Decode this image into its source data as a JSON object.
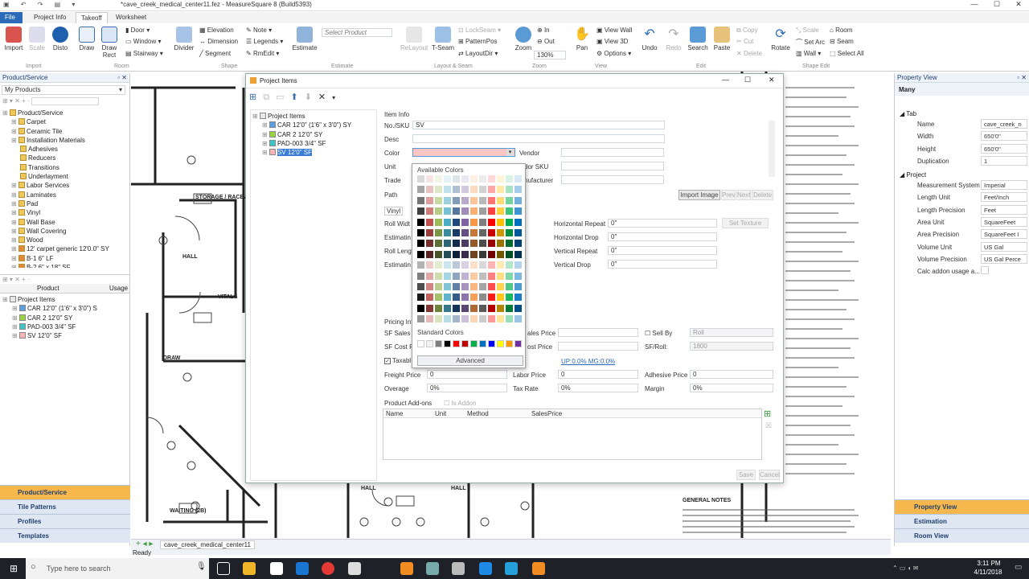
{
  "app": {
    "title": "*cave_creek_medical_center11.fez - MeasureSquare 8 (Build5393)"
  },
  "ribbon_tabs": [
    {
      "label": "File",
      "active": false
    },
    {
      "label": "Project Info",
      "active": false
    },
    {
      "label": "Takeoff",
      "active": true
    },
    {
      "label": "Worksheet",
      "active": false
    }
  ],
  "ribbon": {
    "import": {
      "import": "Import",
      "scale": "Scale",
      "disto": "Disto",
      "group": "Import"
    },
    "room": {
      "draw": "Draw",
      "draw_rect": "Draw\nRect",
      "door": "Door",
      "window": "Window",
      "stairway": "Stairway",
      "group": "Room"
    },
    "shape": {
      "divider": "Divider",
      "elevation": "Elevation",
      "dimension": "Dimension",
      "segment": "Segment",
      "note": "Note",
      "legends": "Legends",
      "rmedit": "RmEdit",
      "group": "Shape"
    },
    "estimate": {
      "estimate": "Estimate",
      "select_product_placeholder": "Select Product",
      "group": "Estimate"
    },
    "layout": {
      "relayout": "ReLayout",
      "tseam": "T-Seam",
      "lockseam": "LockSeam",
      "patternpos": "PatternPos",
      "layoutdir": "LayoutDir",
      "group": "Layout & Seam"
    },
    "zoom": {
      "zoom": "Zoom",
      "in": "In",
      "out": "Out",
      "level": "130%",
      "group": "Zoom"
    },
    "view": {
      "pan": "Pan",
      "view_wall": "View Wall",
      "view_3d": "View 3D",
      "options": "Options",
      "group": "View"
    },
    "edit": {
      "undo": "Undo",
      "redo": "Redo",
      "search": "Search",
      "paste": "Paste",
      "copy": "Copy",
      "cut": "Cut",
      "delete": "Delete",
      "group": "Edit"
    },
    "shape_edit": {
      "rotate": "Rotate",
      "scale": "Scale",
      "set_arc": "Set Arc",
      "wall": "Wall",
      "room": "Room",
      "seam": "Seam",
      "select_all": "Select All",
      "group": "Shape Edit"
    }
  },
  "left_panel": {
    "title": "Product/Service",
    "filter": "My Products",
    "tree": [
      {
        "label": "Product/Service",
        "level": 0
      },
      {
        "label": "Carpet",
        "level": 1
      },
      {
        "label": "Ceramic Tile",
        "level": 1
      },
      {
        "label": "Installation Materials",
        "level": 1
      },
      {
        "label": "Adhesives",
        "level": 2
      },
      {
        "label": "Reducers",
        "level": 2
      },
      {
        "label": "Transitions",
        "level": 2
      },
      {
        "label": "Underlayment",
        "level": 2
      },
      {
        "label": "Labor Services",
        "level": 1
      },
      {
        "label": "Laminates",
        "level": 1
      },
      {
        "label": "Pad",
        "level": 1
      },
      {
        "label": "Vinyl",
        "level": 1
      },
      {
        "label": "Wall Base",
        "level": 1
      },
      {
        "label": "Wall Covering",
        "level": 1
      },
      {
        "label": "Wood",
        "level": 1
      },
      {
        "label": "12' carpet generic 12'0.0\" SY",
        "level": 1
      },
      {
        "label": "B-1 6\" LF",
        "level": 1
      },
      {
        "label": "B-2 6\" x 18\" SF",
        "level": 1
      }
    ],
    "columns": [
      "Product",
      "Usage"
    ],
    "project_items": [
      {
        "label": "Project Items",
        "color": ""
      },
      {
        "label": "CAR 12'0\" (1'6\" x 3'0\") S",
        "color": "#5aa0e0"
      },
      {
        "label": "CAR 2 12'0\" SY",
        "color": "#9bd240"
      },
      {
        "label": "PAD-003 3/4\"  SF",
        "color": "#39c7c7"
      },
      {
        "label": "SV 12'0\" SF",
        "color": "#f7b6b6"
      }
    ],
    "nav": [
      "Product/Service",
      "Tile Patterns",
      "Profiles",
      "Templates"
    ]
  },
  "dialog": {
    "title": "Project Items",
    "tree": [
      {
        "label": "Project Items",
        "color": ""
      },
      {
        "label": "CAR 12'0\" (1'6\" x 3'0\") SY",
        "color": "#5aa0e0"
      },
      {
        "label": "CAR 2 12'0\" SY",
        "color": "#9bd240"
      },
      {
        "label": "PAD-003 3/4\"  SF",
        "color": "#39c7c7"
      },
      {
        "label": "SV 12'0\" SF",
        "color": "#f7b6b6"
      }
    ],
    "item_info": "Item Info",
    "labels": {
      "no_sku": "No./SKU",
      "desc": "Desc",
      "color": "Color",
      "unit": "Unit",
      "trade": "Trade",
      "path": "Path",
      "vendor": "Vendor",
      "vendor_sku": "dor SKU",
      "manufacturer": "nufacturer",
      "vinyl": "Vinyl",
      "roll_width": "Roll Widt",
      "estimating1": "Estimatin",
      "roll_length": "Roll Lengt",
      "estimating2": "Estimatin",
      "horizontal_repeat": "Horizontal Repeat",
      "horizontal_drop": "Horizontal Drop",
      "vertical_repeat": "Vertical Repeat",
      "vertical_drop": "Vertical Drop",
      "pricing": "Pricing Inf",
      "sf_sales": "SF Sales P",
      "sf_cost": "SF Cost P",
      "taxable": "Taxabl",
      "sales_price": "ales Price",
      "cost_price": "ost Price",
      "sell_by": "Sell By",
      "sf_roll": "SF/Roll:",
      "freight": "Freight Price",
      "labor": "Labor Price",
      "adhesive": "Adhesive Price",
      "overage": "Overage",
      "tax_rate": "Tax Rate",
      "margin": "Margin",
      "addons": "Product Add-ons",
      "is_addon": "Is Addon"
    },
    "values": {
      "no_sku": "SV",
      "horizontal_repeat": "0\"",
      "horizontal_drop": "0\"",
      "vertical_repeat": "0\"",
      "vertical_drop": "0\"",
      "sell_by": "Roll",
      "sf_roll": "1800",
      "link": "UP:0.0% MG:0.0%",
      "freight": "0",
      "labor": "0",
      "adhesive": "0",
      "overage": "0%",
      "tax_rate": "0%",
      "margin": "0%"
    },
    "buttons": {
      "import_image": "Import Image",
      "prev": "Prev",
      "next": "Next",
      "delete": "Delete",
      "set_texture": "Set Texture",
      "save": "Save",
      "cancel": "Cancel"
    },
    "addon_columns": [
      "Name",
      "Unit",
      "Method",
      "SalesPrice"
    ],
    "color_value": "#f9c5c5"
  },
  "color_popup": {
    "available": "Available Colors",
    "standard": "Standard Colors",
    "advanced": "Advanced",
    "palette_columns": [
      "#000000",
      "#c0504d",
      "#9bbb59",
      "#4bacc6",
      "#1f497d",
      "#8064a2",
      "#f79646",
      "#7f7f7f",
      "#ff0000",
      "#ffc000",
      "#00b050",
      "#0070c0"
    ],
    "standard_colors": [
      "#ffffff",
      "#f2f2f2",
      "#7f7f7f",
      "#000000",
      "#ff0000",
      "#c00000",
      "#00b050",
      "#0070c0",
      "#0000ff",
      "#ffff00",
      "#ff9900",
      "#7030a0"
    ]
  },
  "property_view": {
    "title": "Property View",
    "selection": "Many",
    "sections": {
      "tab": "Tab",
      "project": "Project"
    },
    "tab_rows": [
      {
        "key": "Name",
        "value": "cave_creek_n"
      },
      {
        "key": "Width",
        "value": "650'0\""
      },
      {
        "key": "Height",
        "value": "650'0\""
      },
      {
        "key": "Duplication",
        "value": "1"
      }
    ],
    "project_rows": [
      {
        "key": "Measurement System",
        "value": "Imperial"
      },
      {
        "key": "Length Unit",
        "value": "Feet/Inch"
      },
      {
        "key": "Length Precision",
        "value": "Feet"
      },
      {
        "key": "Area Unit",
        "value": "SquareFeet"
      },
      {
        "key": "Area Precision",
        "value": "SquareFeet I"
      },
      {
        "key": "Volume Unit",
        "value": "US Gal"
      },
      {
        "key": "Volume Precision",
        "value": "US Gal Perce"
      },
      {
        "key": "Calc addon usage a...",
        "value": ""
      }
    ],
    "nav": [
      "Property View",
      "Estimation",
      "Room View"
    ]
  },
  "drawing": {
    "labels": [
      "STORAGE / RACEWAY",
      "HALL",
      "VITALS",
      "DRAW",
      "WAITING (2B)",
      "HALL",
      "HALL"
    ],
    "notes_header": "GENERAL NOTES"
  },
  "status": {
    "sheet_tab": "cave_creek_medical_center11",
    "status_text": "Ready"
  },
  "taskbar": {
    "search_placeholder": "Type here to search",
    "time": "3:11 PM",
    "date": "4/11/2018"
  }
}
